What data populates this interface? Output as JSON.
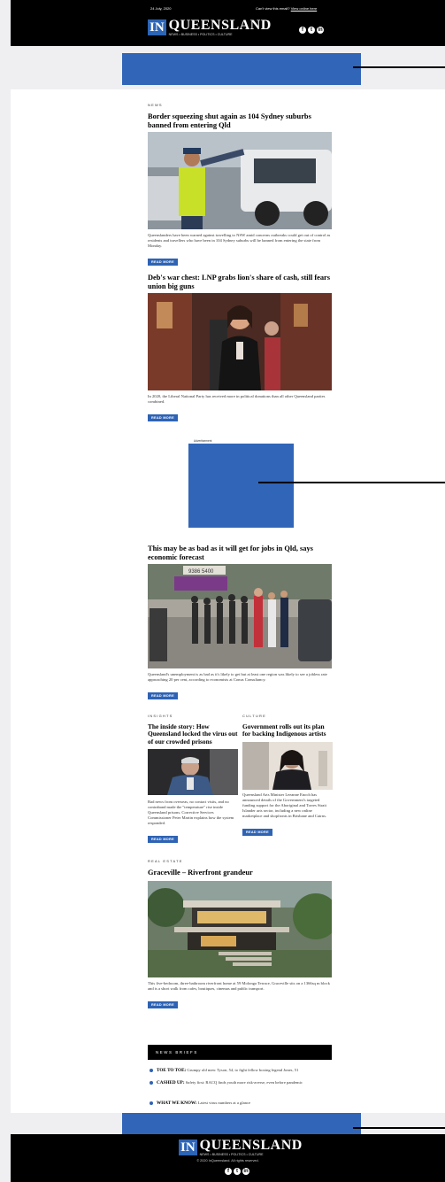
{
  "header": {
    "date": "24 July, 2020",
    "cant_view": "Can't view this email?",
    "view_online": "View online here",
    "logo_in": "IN",
    "logo_name": "QUEENSLAND",
    "tagline": "NEWS • BUSINESS • POLITICS • CULTURE",
    "social": [
      {
        "icon": "facebook-icon",
        "glyph": "f"
      },
      {
        "icon": "twitter-icon",
        "glyph": "t"
      },
      {
        "icon": "linkedin-icon",
        "glyph": "in"
      }
    ]
  },
  "stories": {
    "s1": {
      "kicker": "NEWS",
      "headline": "Border squeezing shut again as 104 Sydney suburbs banned from entering Qld",
      "summary": "Queenslanders have been warned against travelling to NSW amid concerns outbreaks could get out of control as residents and travellers who have been in 104 Sydney suburbs will be banned from entering the state from Monday.",
      "button": "READ MORE"
    },
    "s2": {
      "headline": "Deb's war chest: LNP grabs lion's share of cash, still fears union big guns",
      "summary": "In 2020, the Liberal National Party has received more in political donations than all other Queensland parties combined.",
      "button": "READ MORE"
    },
    "s3": {
      "headline": "This may be as bad as it will get for jobs in Qld, says economic forecast",
      "summary": "Queensland's unemployment is as bad as it's likely to get but at least one region was likely to see a jobless rate approaching 20 per cent, according to economists at Conus Consultancy.",
      "button": "READ MORE",
      "sign_text": "9386 5400"
    },
    "insights": {
      "kicker": "INSIGHTS",
      "headline": "The inside story: How Queensland locked the virus out of our crowded prisons",
      "summary": "Bad news from overseas, no contact visits, and no contraband made the \"temperature\" rise inside Queensland prisons. Corrective Services Commissioner Peter Martin explains how the system responded.",
      "button": "READ MORE"
    },
    "culture": {
      "kicker": "CULTURE",
      "headline": "Government rolls out its plan for backing Indigenous artists",
      "summary": "Queensland Arts Minister Leeanne Enoch has announced details of the Government's targeted funding support for the Aboriginal and Torres Strait Islander arts sector, including a new online marketplace and shopfronts in Brisbane and Cairns.",
      "button": "READ MORE"
    },
    "real_estate": {
      "kicker": "REAL ESTATE",
      "headline": "Graceville – Riverfront grandeur",
      "summary": "This five-bedroom, three-bathroom riverfront home at 59 Molonga Terrace, Graceville sits on a 1366sq m block and is a short walk from cafes, boutiques, cinemas and public transport.",
      "button": "READ MORE"
    }
  },
  "advert_label": "Advertisement",
  "briefs": {
    "title": "NEWS BRIEFS",
    "items": [
      {
        "bold": "TOE TO TOE:",
        "text": "Grumpy old men: Tyson, 54, to fight fellow boxing legend Jones, 51"
      },
      {
        "bold": "CASHED UP:",
        "text": "Safety first: RACQ finds youth more risk-averse, even before pandemic"
      },
      {
        "bold": "WHAT WE KNOW:",
        "text": "Latest virus numbers at a glance"
      }
    ]
  },
  "footer": {
    "logo_in": "IN",
    "logo_name": "QUEENSLAND",
    "tagline": "NEWS • BUSINESS • POLITICS • CULTURE",
    "copyright": "© 2020 InQueensland. All rights reserved."
  },
  "colors": {
    "accent": "#2e63b4",
    "ad_block": "#3165b8",
    "background": "#efeff1"
  }
}
